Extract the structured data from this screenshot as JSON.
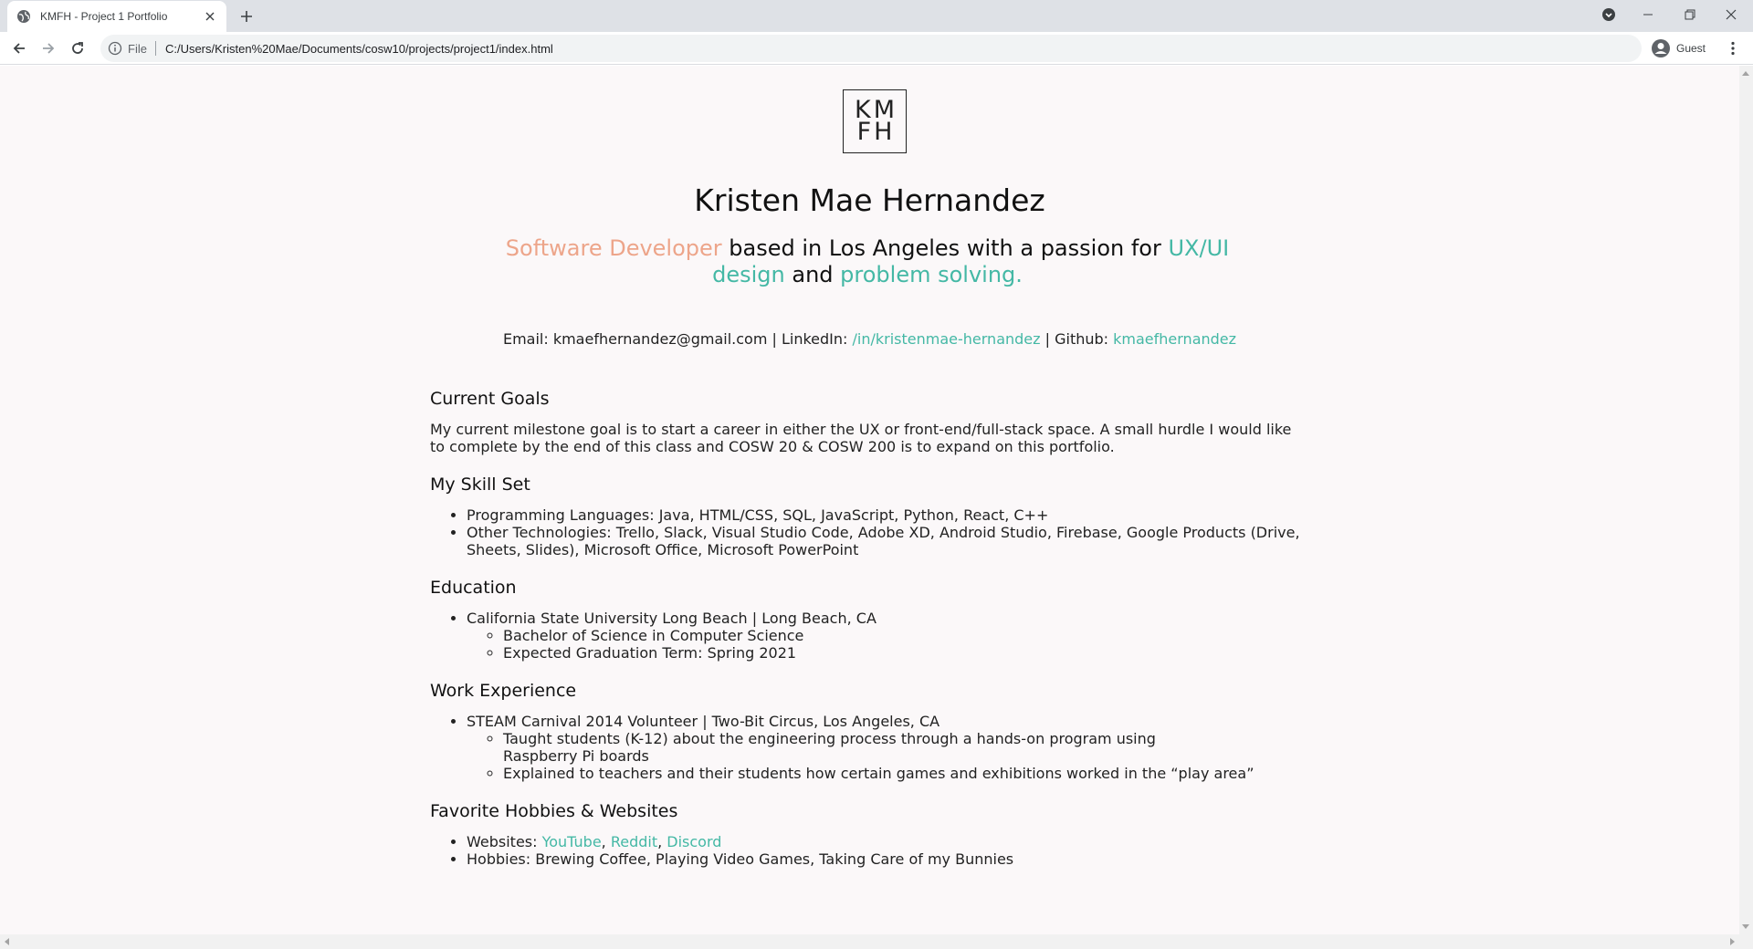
{
  "browser": {
    "tab_title": "KMFH - Project 1 Portfolio",
    "url_scheme": "File",
    "url": "C:/Users/Kristen%20Mae/Documents/cosw10/projects/project1/index.html",
    "profile_label": "Guest"
  },
  "page": {
    "logo": {
      "line1": "KM",
      "line2": "FH"
    },
    "name": "Kristen Mae Hernandez",
    "tagline": {
      "role": "Software Developer",
      "mid1": " based in Los Angeles with a passion for ",
      "focus1": "UX/UI design",
      "mid2": " and ",
      "focus2": "problem solving."
    },
    "contact": {
      "email_label": "Email: kmaefhernandez@gmail.com | LinkedIn: ",
      "linkedin": "/in/kristenmae-hernandez",
      "github_label": " | Github: ",
      "github": "kmaefhernandez"
    },
    "goals": {
      "title": "Current Goals",
      "text": "My current milestone goal is to start a career in either the UX or front-end/full-stack space. A small hurdle I would like to complete by the end of this class and COSW 20 & COSW 200 is to expand on this portfolio."
    },
    "skills": {
      "title": "My Skill Set",
      "items": [
        "Programming Languages: Java, HTML/CSS, SQL, JavaScript, Python, React, C++",
        "Other Technologies: Trello, Slack, Visual Studio Code, Adobe XD, Android Studio, Firebase, Google Products (Drive, Sheets, Slides), Microsoft Office, Microsoft PowerPoint"
      ]
    },
    "education": {
      "title": "Education",
      "school": "California State University Long Beach | Long Beach, CA",
      "details": [
        "Bachelor of Science in Computer Science",
        "Expected Graduation Term: Spring 2021"
      ]
    },
    "work": {
      "title": "Work Experience",
      "job": "STEAM Carnival 2014 Volunteer | Two-Bit Circus, Los Angeles, CA",
      "details": [
        "Taught students (K-12) about the engineering process through a hands-on program using Raspberry Pi boards",
        "Explained to teachers and their students how certain games and exhibitions worked in the “play area”"
      ]
    },
    "hobbies": {
      "title": "Favorite Hobbies & Websites",
      "websites_label": "Websites: ",
      "sites": [
        "YouTube",
        "Reddit",
        "Discord"
      ],
      "separator": ", ",
      "hobbies_text": "Hobbies: Brewing Coffee, Playing Video Games, Taking Care of my Bunnies"
    }
  },
  "colors": {
    "accent_peach": "#eda58a",
    "accent_teal": "#44b8a5",
    "page_background": "#fbf8f9"
  }
}
